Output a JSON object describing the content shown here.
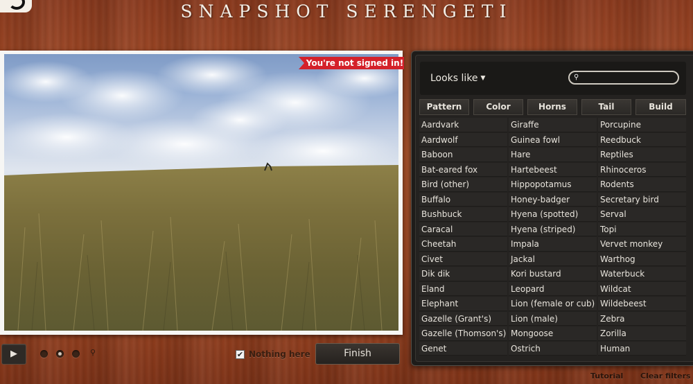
{
  "header": {
    "title": "SNAPSHOT SERENGETI"
  },
  "subject": {
    "banner": "You're not signed in!"
  },
  "controls": {
    "play_icon": "play-icon",
    "nothing_here_label": "Nothing here",
    "nothing_here_checked": true,
    "finish_label": "Finish"
  },
  "classifier": {
    "looks_like_label": "Looks like",
    "search_value": "",
    "tabs": [
      {
        "label": "Pattern"
      },
      {
        "label": "Color"
      },
      {
        "label": "Horns"
      },
      {
        "label": "Tail"
      },
      {
        "label": "Build"
      }
    ],
    "species_columns": [
      [
        "Aardvark",
        "Aardwolf",
        "Baboon",
        "Bat-eared fox",
        "Bird (other)",
        "Buffalo",
        "Bushbuck",
        "Caracal",
        "Cheetah",
        "Civet",
        "Dik dik",
        "Eland",
        "Elephant",
        "Gazelle (Grant's)",
        "Gazelle (Thomson's)",
        "Genet"
      ],
      [
        "Giraffe",
        "Guinea fowl",
        "Hare",
        "Hartebeest",
        "Hippopotamus",
        "Honey-badger",
        "Hyena (spotted)",
        "Hyena (striped)",
        "Impala",
        "Jackal",
        "Kori bustard",
        "Leopard",
        "Lion (female or cub)",
        "Lion (male)",
        "Mongoose",
        "Ostrich"
      ],
      [
        "Porcupine",
        "Reedbuck",
        "Reptiles",
        "Rhinoceros",
        "Rodents",
        "Secretary bird",
        "Serval",
        "Topi",
        "Vervet monkey",
        "Warthog",
        "Waterbuck",
        "Wildcat",
        "Wildebeest",
        "Zebra",
        "Zorilla",
        "Human"
      ]
    ]
  },
  "footer": {
    "tutorial_label": "Tutorial",
    "clear_filters_label": "Clear filters"
  }
}
